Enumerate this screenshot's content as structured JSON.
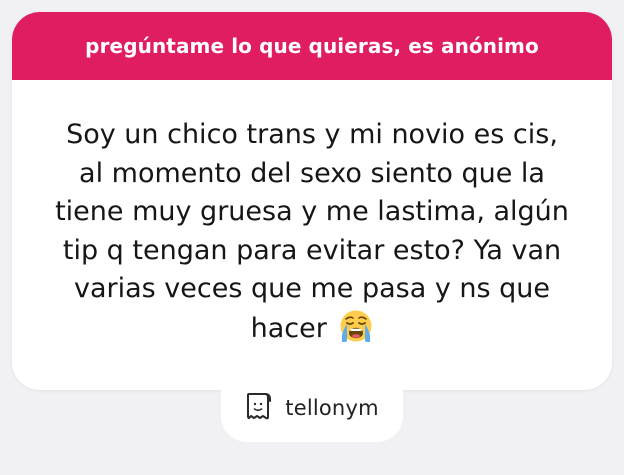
{
  "card": {
    "header_text": "pregúntame lo que quieras, es anónimo",
    "question_text": "Soy un chico trans y mi novio es cis, al momento del sexo siento que la tiene muy gruesa y me lastima, algún tip q tengan para evitar esto? Ya van varias veces que me pasa y ns que hacer",
    "emoji_icon": "loudly-crying-face-emoji"
  },
  "brand": {
    "name": "tellonym",
    "icon": "tellonym-logo-icon"
  },
  "colors": {
    "accent": "#e01c63",
    "background": "#f1f1f3",
    "card": "#ffffff",
    "text": "#161616"
  }
}
